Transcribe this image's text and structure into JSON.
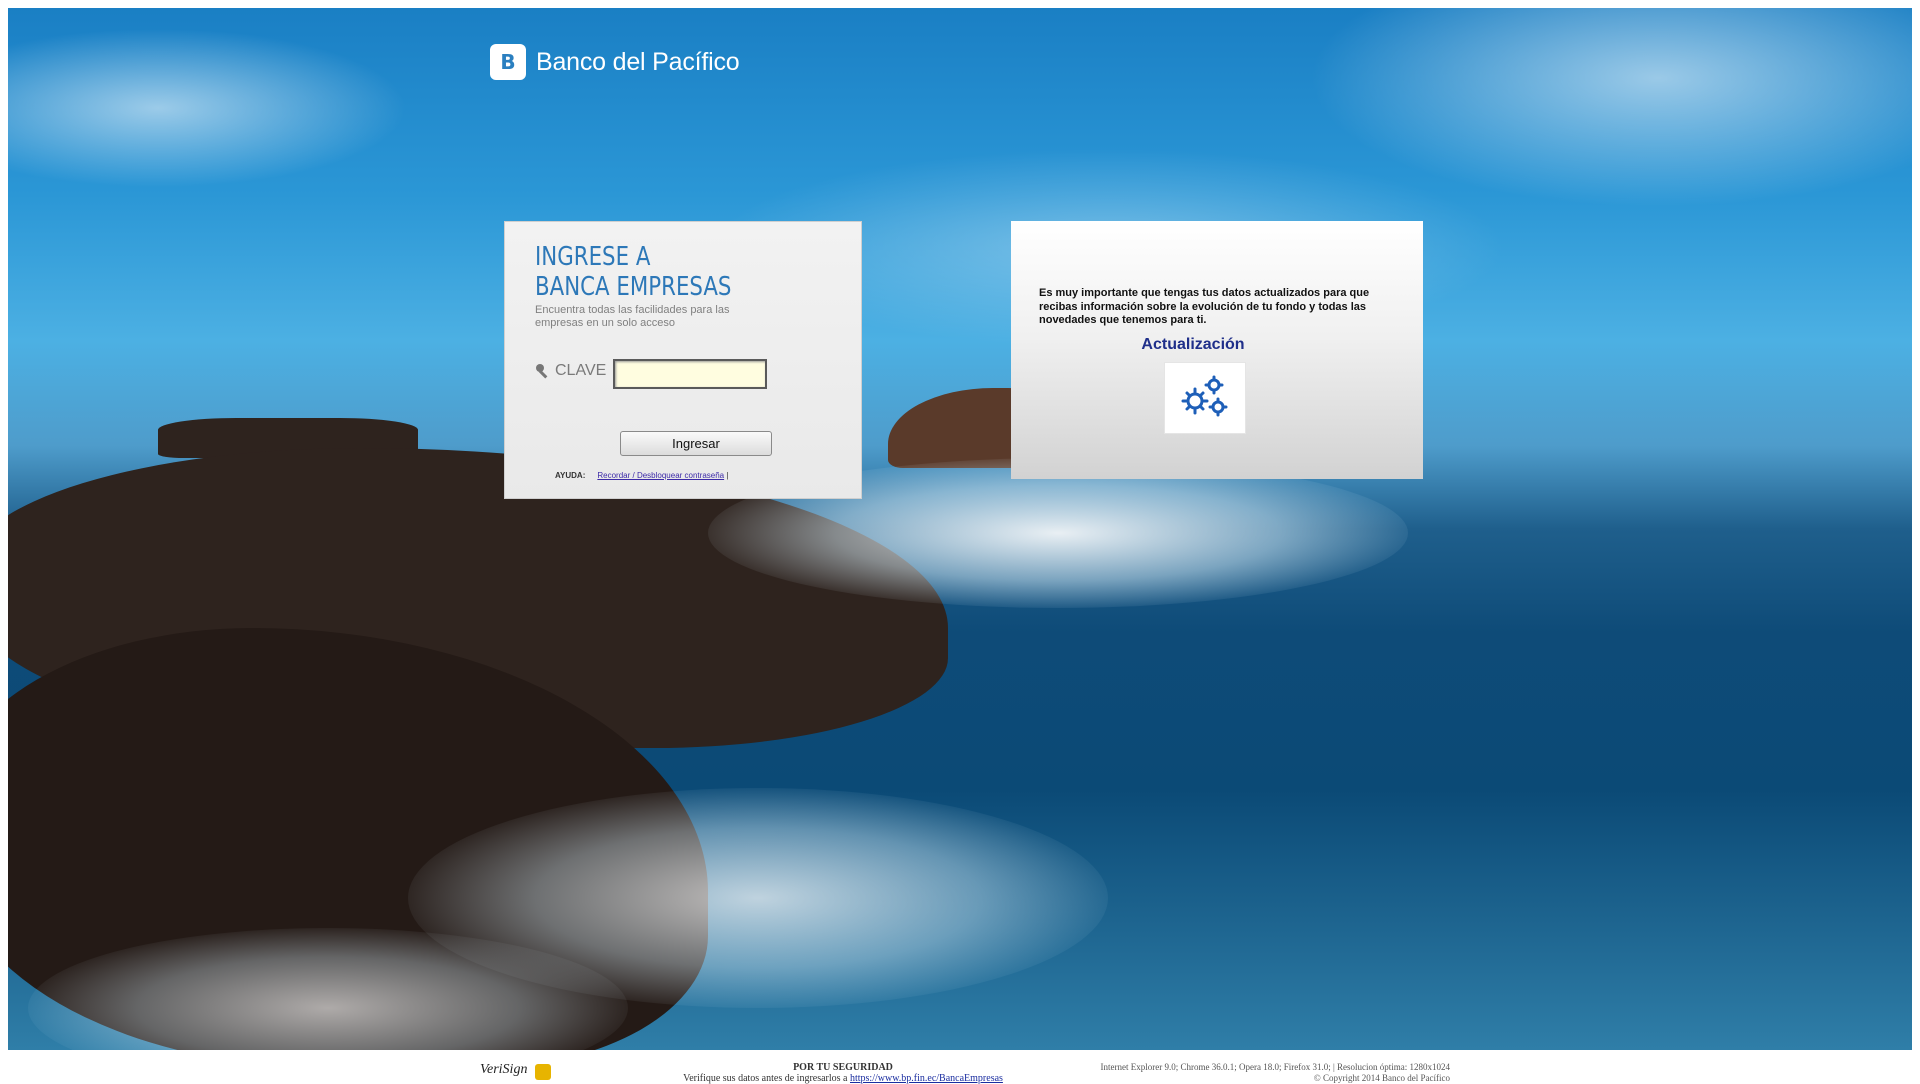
{
  "brand": {
    "name": "Banco del Pacífico",
    "logo_mark": "B"
  },
  "login": {
    "title_line1": "INGRESE A",
    "title_line2": "BANCA EMPRESAS",
    "subtitle": "Encuentra todas las facilidades para las empresas en un solo acceso",
    "clave_label": "CLAVE",
    "clave_value": "",
    "submit_label": "Ingresar",
    "help_label": "AYUDA:",
    "help_link": "Recordar / Desbloquear contraseña",
    "help_sep": "|"
  },
  "info": {
    "message": "Es muy importante que tengas tus datos actualizados para que recibas información sobre la evolución de tu fondo y todas las novedades que tenemos para ti.",
    "action_label": "Actualización",
    "action_icon": "gears-icon"
  },
  "footer": {
    "verisign_label": "VeriSign",
    "security_title": "POR TU SEGURIDAD",
    "security_text": "Verifique sus datos antes de ingresarlos a",
    "security_url": "https://www.bp.fin.ec/BancaEmpresas",
    "browsers": "Internet Explorer 9.0; Chrome 36.0.1; Opera 18.0; Firefox 31.0; | Resolucion óptima: 1280x1024",
    "copyright": "© Copyright 2014 Banco del Pacífico"
  },
  "colors": {
    "brand_blue": "#2d78b8",
    "link_purple": "#3c2aa8",
    "action_blue": "#1f2f8a",
    "input_bg": "#fffde0"
  }
}
